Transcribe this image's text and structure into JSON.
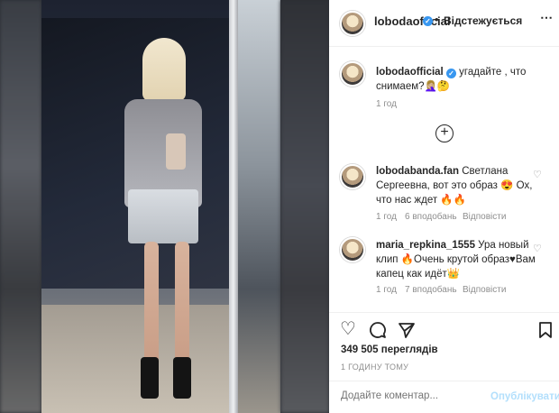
{
  "post": {
    "author": "lobodaofficial",
    "follow_label": "Відстежується",
    "more_icon": "⋯",
    "caption_text": "угадайте , что снимаем?🤦🏼‍♀️🤔",
    "caption_time": "1 год",
    "load_more_icon": "+"
  },
  "comments": [
    {
      "username": "lobodabanda.fan",
      "text": "Светлана Сергеевна, вот это образ 😍 Ох, что нас ждет 🔥🔥",
      "time": "1 год",
      "likes": "6 вподобань",
      "reply": "Відповісти"
    },
    {
      "username": "maria_repkina_1555",
      "text": "Ура новый клип 🔥Очень крутой образ♥Вам капец как идёт👑",
      "time": "1 год",
      "likes": "7 вподобань",
      "reply": "Відповісти"
    }
  ],
  "actions": {
    "views": "349 505 переглядів",
    "posted_ago": "1 ГОДИНУ ТОМУ"
  },
  "comment_form": {
    "placeholder": "Додайте коментар...",
    "publish_label": "Опублікувати"
  },
  "colors": {
    "verified": "#3897f0",
    "publish_disabled": "#b2dffc",
    "muted": "#8e8e8e"
  }
}
